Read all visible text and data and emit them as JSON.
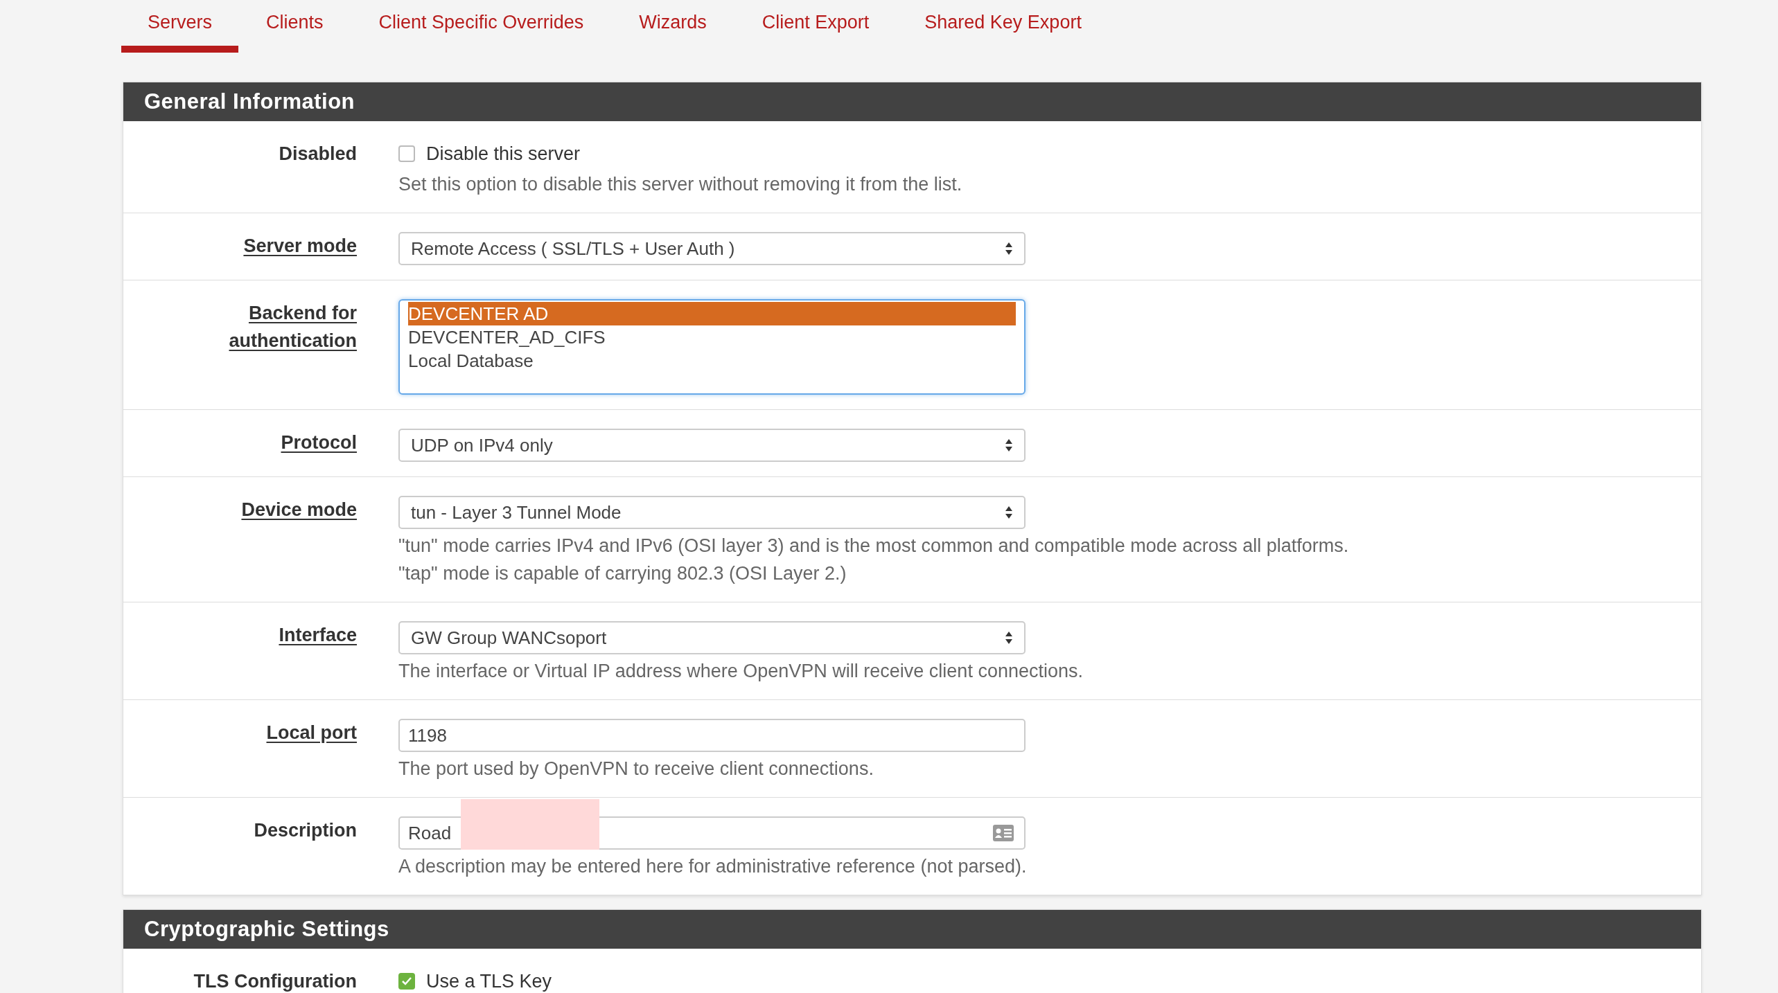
{
  "tabs": [
    {
      "label": "Servers",
      "selected": true
    },
    {
      "label": "Clients",
      "selected": false
    },
    {
      "label": "Client Specific Overrides",
      "selected": false
    },
    {
      "label": "Wizards",
      "selected": false
    },
    {
      "label": "Client Export",
      "selected": false
    },
    {
      "label": "Shared Key Export",
      "selected": false
    }
  ],
  "sections": [
    {
      "title": "General Information",
      "rows": [
        {
          "kind": "checkbox",
          "label": "Disabled",
          "underlined": false,
          "checked": false,
          "caption": "Disable this server",
          "help": [
            "Set this option to disable this server without removing it from the list."
          ]
        },
        {
          "kind": "select",
          "label": "Server mode",
          "underlined": true,
          "value": "Remote Access ( SSL/TLS + User Auth )"
        },
        {
          "kind": "listbox",
          "label": "Backend for authentication",
          "underlined": true,
          "options": [
            {
              "label": "DEVCENTER AD",
              "selected": true
            },
            {
              "label": "DEVCENTER_AD_CIFS",
              "selected": false
            },
            {
              "label": "Local Database",
              "selected": false
            }
          ]
        },
        {
          "kind": "select",
          "label": "Protocol",
          "underlined": true,
          "value": "UDP on IPv4 only"
        },
        {
          "kind": "select",
          "label": "Device mode",
          "underlined": true,
          "value": "tun - Layer 3 Tunnel Mode",
          "help": [
            "\"tun\" mode carries IPv4 and IPv6 (OSI layer 3) and is the most common and compatible mode across all platforms.",
            "\"tap\" mode is capable of carrying 802.3 (OSI Layer 2.)"
          ]
        },
        {
          "kind": "select",
          "label": "Interface",
          "underlined": true,
          "value": "GW Group WANCsoport",
          "help": [
            "The interface or Virtual IP address where OpenVPN will receive client connections."
          ]
        },
        {
          "kind": "input",
          "label": "Local port",
          "underlined": true,
          "value": "1198",
          "help": [
            "The port used by OpenVPN to receive client connections."
          ]
        },
        {
          "kind": "input",
          "label": "Description",
          "underlined": false,
          "value": "Road",
          "redacted": true,
          "card_icon": true,
          "help": [
            "A description may be entered here for administrative reference (not parsed)."
          ]
        }
      ]
    },
    {
      "title": "Cryptographic Settings",
      "rows": [
        {
          "kind": "checkbox",
          "label": "TLS Configuration",
          "underlined": false,
          "checked": true,
          "caption": "Use a TLS Key"
        }
      ]
    }
  ]
}
